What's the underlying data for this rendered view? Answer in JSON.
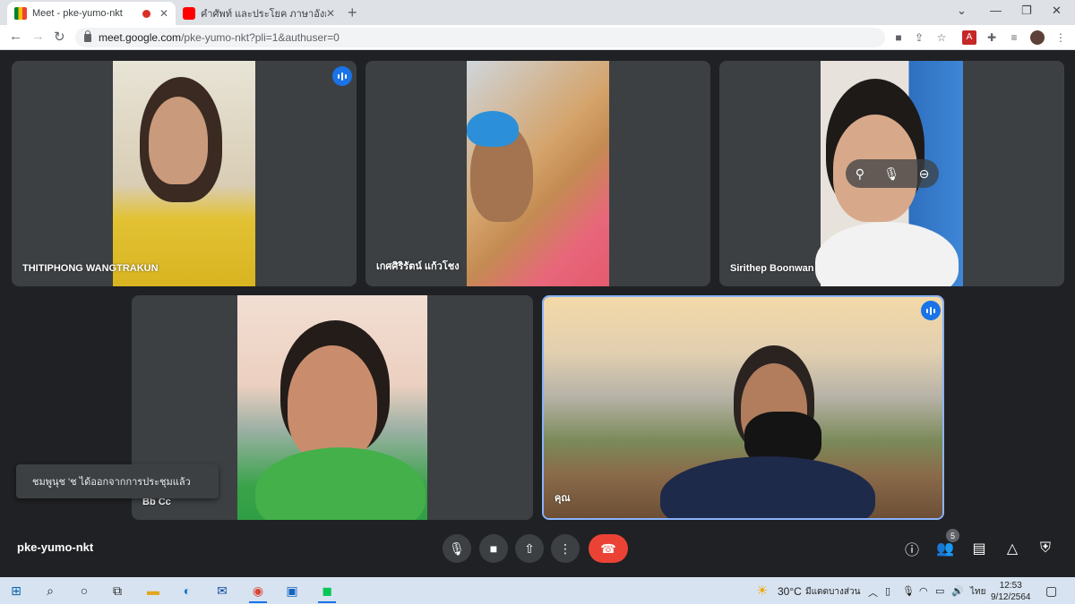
{
  "browser": {
    "tabs": [
      {
        "title": "Meet - pke-yumo-nkt",
        "favicon": "google-meet-icon"
      },
      {
        "title": "คำศัพท์ และประโยค ภาษาอังกฤษ ในชีวิต",
        "favicon": "youtube-icon"
      }
    ],
    "url": {
      "host": "meet.google.com",
      "path": "/pke-yumo-nkt?pli=1&authuser=0"
    }
  },
  "meeting": {
    "code": "pke-yumo-nkt",
    "participants_count": "5",
    "toast": "ชมพูนุช 'ช ได้ออกจากการประชุมแล้ว",
    "participants": [
      {
        "name": "THITIPHONG WANGTRAKUN",
        "speaking": true
      },
      {
        "name": "เกศศิริรัตน์ แก้วโชง",
        "speaking": false
      },
      {
        "name": "Sirithep Boonwan",
        "speaking": false
      },
      {
        "name": "Bb Cc",
        "speaking": false
      },
      {
        "name": "คุณ",
        "speaking": true
      }
    ]
  },
  "taskbar": {
    "temperature": "30°C",
    "weather": "มีแดดบางส่วน",
    "language": "ไทย",
    "time": "12:53",
    "date": "9/12/2564"
  },
  "colors": {
    "accent": "#1a73e8",
    "end_call": "#ea4335",
    "tile": "#3c4043",
    "background": "#202124"
  }
}
